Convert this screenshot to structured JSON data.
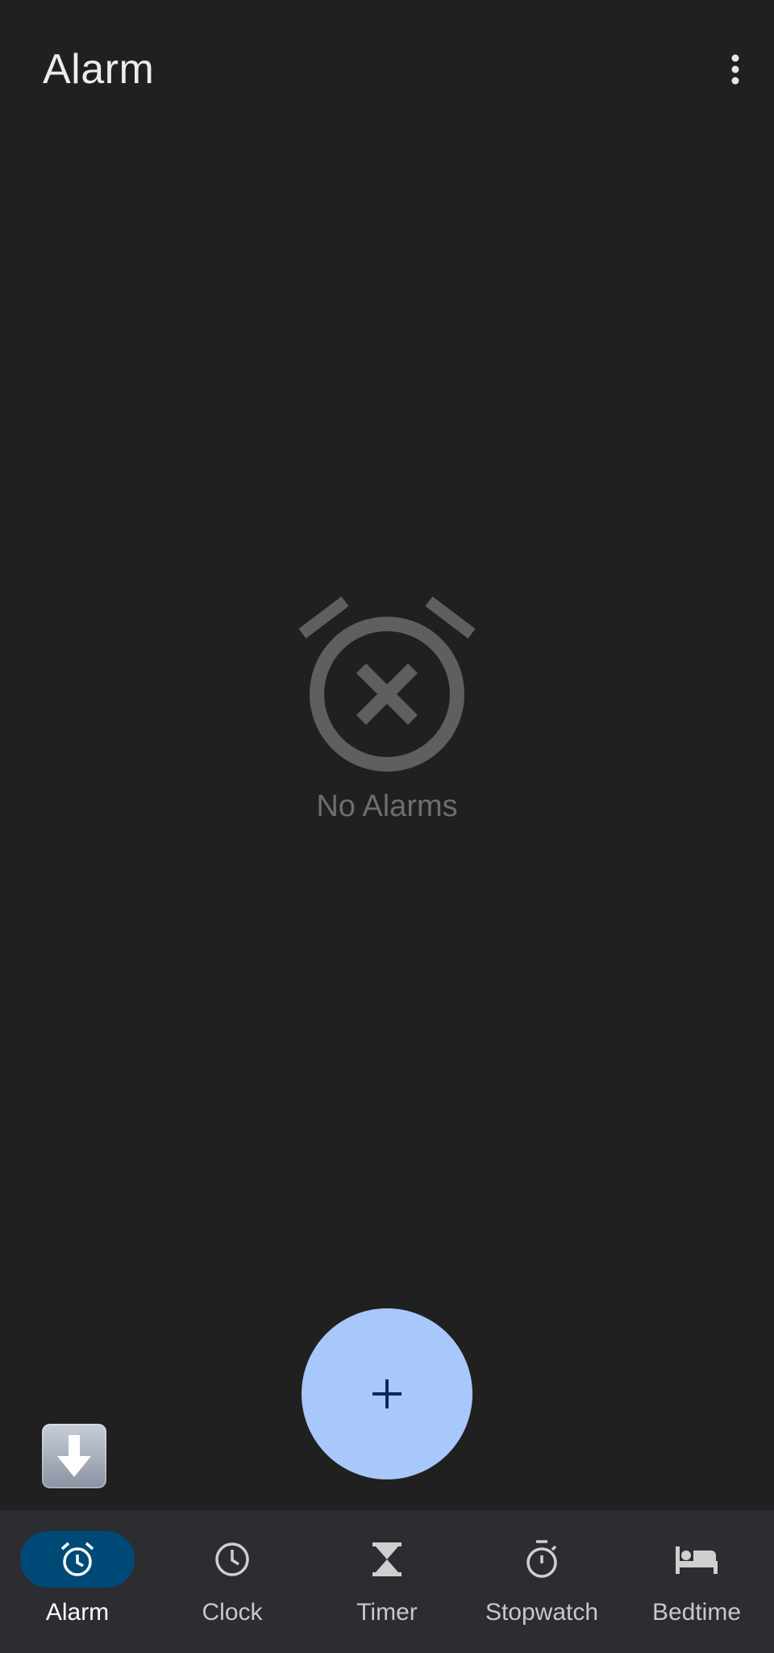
{
  "header": {
    "title": "Alarm",
    "menu_icon": "more-vert-icon"
  },
  "empty_state": {
    "icon": "alarm-off-icon",
    "label": "No Alarms"
  },
  "fab": {
    "icon": "plus-icon"
  },
  "download_badge": {
    "icon": "down-arrow-icon"
  },
  "bottom_nav": {
    "active": "Alarm",
    "items": [
      {
        "label": "Alarm",
        "icon": "alarm-icon"
      },
      {
        "label": "Clock",
        "icon": "clock-icon"
      },
      {
        "label": "Timer",
        "icon": "hourglass-icon"
      },
      {
        "label": "Stopwatch",
        "icon": "stopwatch-icon"
      },
      {
        "label": "Bedtime",
        "icon": "bed-icon"
      }
    ]
  },
  "colors": {
    "background": "#202020",
    "fab": "#a8c7fa",
    "nav_background": "#2c2d31",
    "active_pill": "#004a77",
    "empty_icon": "#5f5f5f"
  }
}
